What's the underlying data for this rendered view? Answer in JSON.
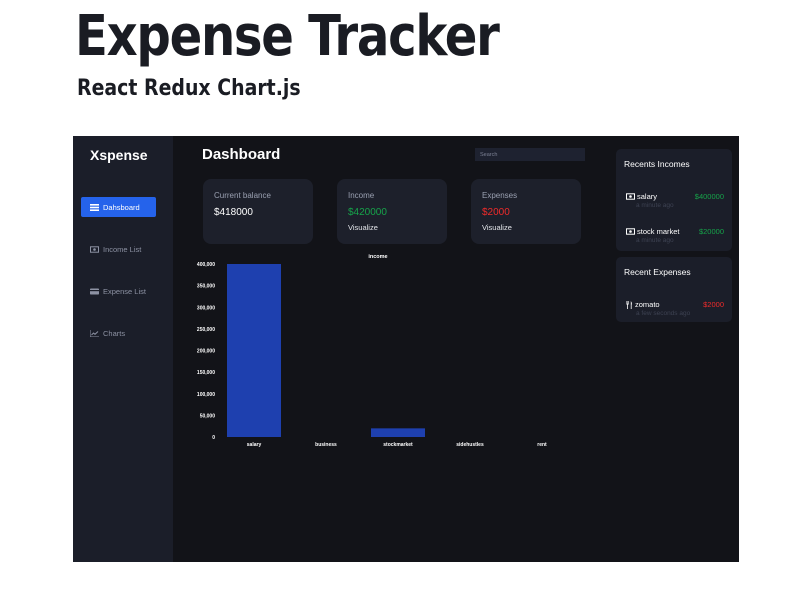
{
  "banner": {
    "title": "Expense Tracker",
    "subtitle": "React Redux Chart.js"
  },
  "sidebar": {
    "logo": "Xspense",
    "items": [
      {
        "label": "Dahsboard",
        "icon": "dashboard-icon",
        "active": true
      },
      {
        "label": "Income List",
        "icon": "cash-icon"
      },
      {
        "label": "Expense List",
        "icon": "card-icon"
      },
      {
        "label": "Charts",
        "icon": "line-chart-icon"
      }
    ]
  },
  "header": {
    "title": "Dashboard",
    "search_placeholder": "Search"
  },
  "cards": [
    {
      "label": "Current balance",
      "value": "$418000",
      "link": ""
    },
    {
      "label": "Income",
      "value": "$420000",
      "link": "Visualize"
    },
    {
      "label": "Expenses",
      "value": "$2000",
      "link": "Visualize"
    }
  ],
  "recent_incomes": {
    "title": "Recents Incomes",
    "items": [
      {
        "name": "salary",
        "amount": "$400000",
        "time": "a minute ago",
        "icon": "cash-icon"
      },
      {
        "name": "stock market",
        "amount": "$20000",
        "time": "a minute ago",
        "icon": "cash-icon"
      }
    ]
  },
  "recent_expenses": {
    "title": "Recent Expenses",
    "items": [
      {
        "name": "zomato",
        "amount": "$2000",
        "time": "a few seconds ago",
        "icon": "fork-knife-icon"
      }
    ]
  },
  "colors": {
    "accent": "#2563eb",
    "bar": "#1e40af",
    "income": "#16a34a",
    "expense": "#ef2b2b",
    "background": "#121318",
    "sidebar": "#1b1e29"
  },
  "chart_data": {
    "type": "bar",
    "title": "income",
    "categories": [
      "salary",
      "business",
      "stockmarket",
      "sidehustles",
      "rent"
    ],
    "values": [
      400000,
      0,
      20000,
      0,
      0
    ],
    "ylim": [
      0,
      400000
    ],
    "yticks": [
      0,
      50000,
      100000,
      150000,
      200000,
      250000,
      300000,
      350000,
      400000
    ],
    "ytick_labels": [
      "0",
      "50,000",
      "100,000",
      "150,000",
      "200,000",
      "250,000",
      "300,000",
      "350,000",
      "400,000"
    ],
    "xlabel": "",
    "ylabel": "",
    "grid": false,
    "legend": "none"
  }
}
